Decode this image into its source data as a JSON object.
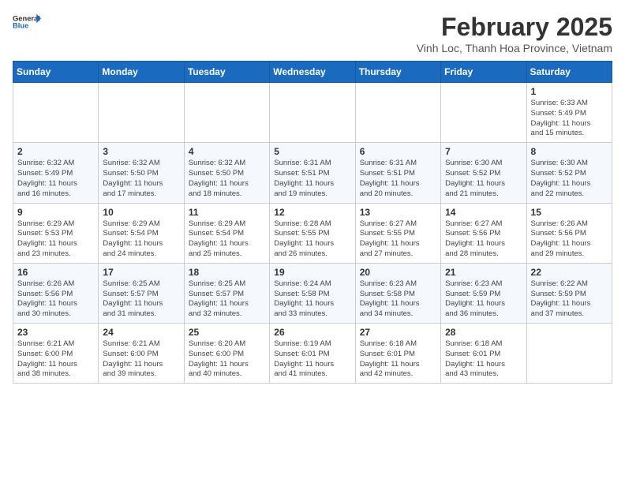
{
  "header": {
    "logo_general": "General",
    "logo_blue": "Blue",
    "month_year": "February 2025",
    "location": "Vinh Loc, Thanh Hoa Province, Vietnam"
  },
  "weekdays": [
    "Sunday",
    "Monday",
    "Tuesday",
    "Wednesday",
    "Thursday",
    "Friday",
    "Saturday"
  ],
  "weeks": [
    [
      {
        "day": "",
        "info": ""
      },
      {
        "day": "",
        "info": ""
      },
      {
        "day": "",
        "info": ""
      },
      {
        "day": "",
        "info": ""
      },
      {
        "day": "",
        "info": ""
      },
      {
        "day": "",
        "info": ""
      },
      {
        "day": "1",
        "info": "Sunrise: 6:33 AM\nSunset: 5:49 PM\nDaylight: 11 hours\nand 15 minutes."
      }
    ],
    [
      {
        "day": "2",
        "info": "Sunrise: 6:32 AM\nSunset: 5:49 PM\nDaylight: 11 hours\nand 16 minutes."
      },
      {
        "day": "3",
        "info": "Sunrise: 6:32 AM\nSunset: 5:50 PM\nDaylight: 11 hours\nand 17 minutes."
      },
      {
        "day": "4",
        "info": "Sunrise: 6:32 AM\nSunset: 5:50 PM\nDaylight: 11 hours\nand 18 minutes."
      },
      {
        "day": "5",
        "info": "Sunrise: 6:31 AM\nSunset: 5:51 PM\nDaylight: 11 hours\nand 19 minutes."
      },
      {
        "day": "6",
        "info": "Sunrise: 6:31 AM\nSunset: 5:51 PM\nDaylight: 11 hours\nand 20 minutes."
      },
      {
        "day": "7",
        "info": "Sunrise: 6:30 AM\nSunset: 5:52 PM\nDaylight: 11 hours\nand 21 minutes."
      },
      {
        "day": "8",
        "info": "Sunrise: 6:30 AM\nSunset: 5:52 PM\nDaylight: 11 hours\nand 22 minutes."
      }
    ],
    [
      {
        "day": "9",
        "info": "Sunrise: 6:29 AM\nSunset: 5:53 PM\nDaylight: 11 hours\nand 23 minutes."
      },
      {
        "day": "10",
        "info": "Sunrise: 6:29 AM\nSunset: 5:54 PM\nDaylight: 11 hours\nand 24 minutes."
      },
      {
        "day": "11",
        "info": "Sunrise: 6:29 AM\nSunset: 5:54 PM\nDaylight: 11 hours\nand 25 minutes."
      },
      {
        "day": "12",
        "info": "Sunrise: 6:28 AM\nSunset: 5:55 PM\nDaylight: 11 hours\nand 26 minutes."
      },
      {
        "day": "13",
        "info": "Sunrise: 6:27 AM\nSunset: 5:55 PM\nDaylight: 11 hours\nand 27 minutes."
      },
      {
        "day": "14",
        "info": "Sunrise: 6:27 AM\nSunset: 5:56 PM\nDaylight: 11 hours\nand 28 minutes."
      },
      {
        "day": "15",
        "info": "Sunrise: 6:26 AM\nSunset: 5:56 PM\nDaylight: 11 hours\nand 29 minutes."
      }
    ],
    [
      {
        "day": "16",
        "info": "Sunrise: 6:26 AM\nSunset: 5:56 PM\nDaylight: 11 hours\nand 30 minutes."
      },
      {
        "day": "17",
        "info": "Sunrise: 6:25 AM\nSunset: 5:57 PM\nDaylight: 11 hours\nand 31 minutes."
      },
      {
        "day": "18",
        "info": "Sunrise: 6:25 AM\nSunset: 5:57 PM\nDaylight: 11 hours\nand 32 minutes."
      },
      {
        "day": "19",
        "info": "Sunrise: 6:24 AM\nSunset: 5:58 PM\nDaylight: 11 hours\nand 33 minutes."
      },
      {
        "day": "20",
        "info": "Sunrise: 6:23 AM\nSunset: 5:58 PM\nDaylight: 11 hours\nand 34 minutes."
      },
      {
        "day": "21",
        "info": "Sunrise: 6:23 AM\nSunset: 5:59 PM\nDaylight: 11 hours\nand 36 minutes."
      },
      {
        "day": "22",
        "info": "Sunrise: 6:22 AM\nSunset: 5:59 PM\nDaylight: 11 hours\nand 37 minutes."
      }
    ],
    [
      {
        "day": "23",
        "info": "Sunrise: 6:21 AM\nSunset: 6:00 PM\nDaylight: 11 hours\nand 38 minutes."
      },
      {
        "day": "24",
        "info": "Sunrise: 6:21 AM\nSunset: 6:00 PM\nDaylight: 11 hours\nand 39 minutes."
      },
      {
        "day": "25",
        "info": "Sunrise: 6:20 AM\nSunset: 6:00 PM\nDaylight: 11 hours\nand 40 minutes."
      },
      {
        "day": "26",
        "info": "Sunrise: 6:19 AM\nSunset: 6:01 PM\nDaylight: 11 hours\nand 41 minutes."
      },
      {
        "day": "27",
        "info": "Sunrise: 6:18 AM\nSunset: 6:01 PM\nDaylight: 11 hours\nand 42 minutes."
      },
      {
        "day": "28",
        "info": "Sunrise: 6:18 AM\nSunset: 6:01 PM\nDaylight: 11 hours\nand 43 minutes."
      },
      {
        "day": "",
        "info": ""
      }
    ]
  ]
}
